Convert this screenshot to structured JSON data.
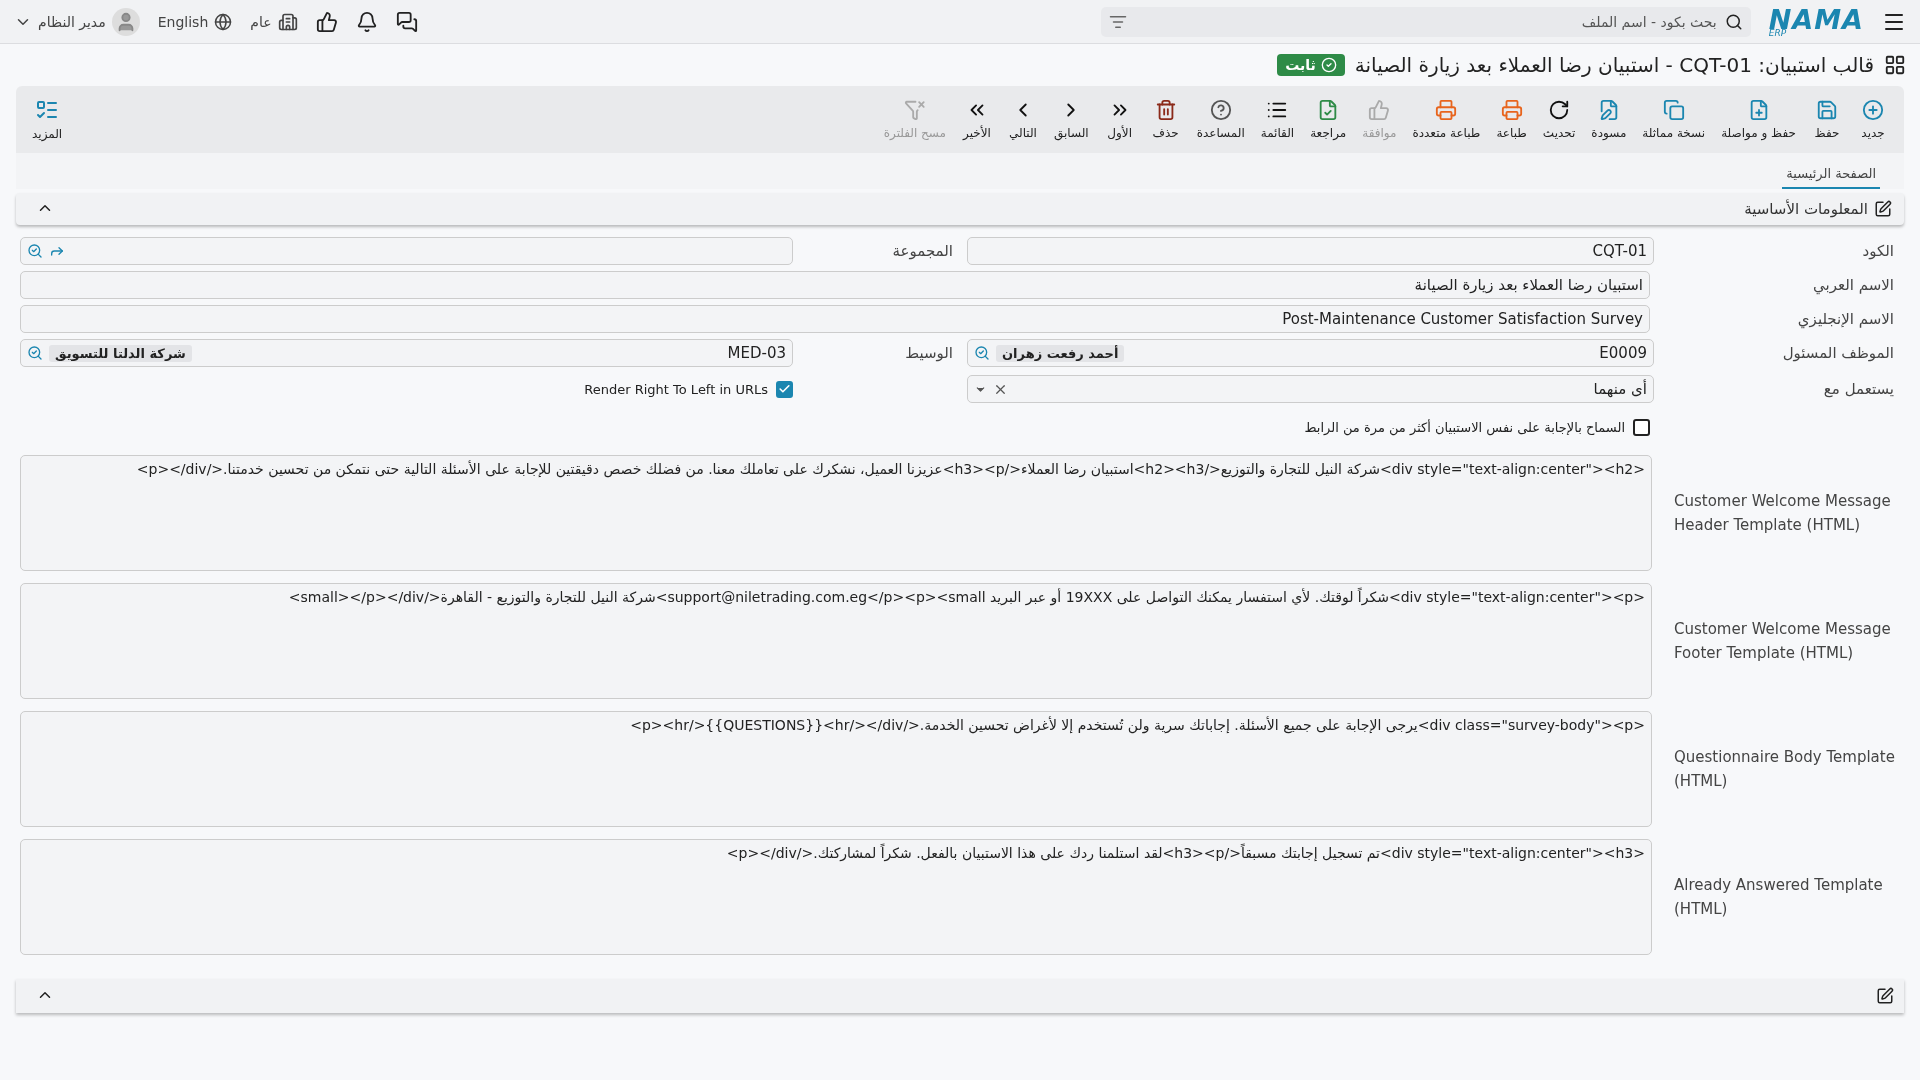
{
  "topbar": {
    "logo": "NAMA",
    "logo_sub": "ERP",
    "search": {
      "placeholder": "بحث بكود - اسم الملف"
    },
    "company": "عام",
    "language": "English",
    "user": "مدير النظام"
  },
  "title": "قالب استبيان: CQT-01 - استبيان رضا العملاء بعد زيارة الصيانة",
  "status_badge": "ثابت",
  "toolbar": [
    {
      "label": "جديد",
      "disabled": false
    },
    {
      "label": "حفظ",
      "disabled": false
    },
    {
      "label": "حفظ و مواصلة",
      "disabled": false
    },
    {
      "label": "نسخة مماثلة",
      "disabled": false
    },
    {
      "label": "مسودة",
      "disabled": false
    },
    {
      "label": "تحديث",
      "disabled": false
    },
    {
      "label": "طباعة",
      "disabled": false
    },
    {
      "label": "طباعة متعددة",
      "disabled": false
    },
    {
      "label": "موافقة",
      "disabled": true
    },
    {
      "label": "مراجعة",
      "disabled": false
    },
    {
      "label": "القائمة",
      "disabled": false
    },
    {
      "label": "المساعدة",
      "disabled": false
    },
    {
      "label": "حذف",
      "disabled": false
    },
    {
      "label": "الأول",
      "disabled": false
    },
    {
      "label": "السابق",
      "disabled": false
    },
    {
      "label": "التالي",
      "disabled": false
    },
    {
      "label": "الأخير",
      "disabled": false
    },
    {
      "label": "مسح الفلترة",
      "disabled": true
    }
  ],
  "more": "المزيد",
  "tabs": [
    {
      "label": "الصفحة الرئيسية",
      "selected": true
    }
  ],
  "section": {
    "title": "المعلومات الأساسية",
    "expanded": true
  },
  "form": {
    "code": {
      "label": "الكود",
      "value": "CQT-01"
    },
    "group": {
      "label": "المجموعة"
    },
    "arabic_name": {
      "label": "الاسم العربي",
      "value": "استبيان رضا العملاء بعد زيارة الصيانة"
    },
    "english_name": {
      "label": "الاسم الإنجليزي",
      "value": "Post-Maintenance Customer Satisfaction Survey"
    },
    "employee": {
      "label": "الموظف المسئول",
      "value": "E0009",
      "chip": "أحمد رفعت زهران"
    },
    "broker": {
      "label": "الوسيط",
      "value": "MED-03",
      "chip": "شركة الدلتا للتسويق"
    },
    "used_with": {
      "label": "يستعمل مع",
      "value": "أى منهما"
    },
    "rtl_urls": {
      "label": "Render Right To Left in URLs",
      "checked": true
    },
    "allow_multiple": {
      "label": "السماح بالإجابة على نفس الاستبيان أكثر من مرة من الرابط",
      "checked": false
    },
    "templates": [
      {
        "label": "Customer Welcome Message Header Template (HTML)",
        "value": "<div style=\"text-align:center\"><h2>شركة النيل للتجارة والتوزيع</h2><h3>استبيان رضا العملاء</h3><p>عزيزنا العميل، نشكرك على تعاملك معنا. من فضلك خصص دقيقتين للإجابة على الأسئلة التالية حتى نتمكن من تحسين خدمتنا.</p></div>"
      },
      {
        "label": "Customer Welcome Message Footer Template (HTML)",
        "value": "<div style=\"text-align:center\"><p>شكراً لوقتك. لأي استفسار يمكنك التواصل على 19XXX أو عبر البريد support@niletrading.com.eg</p><p><small>شركة النيل للتجارة والتوزيع - القاهرة</small></p></div>"
      },
      {
        "label": "Questionnaire Body Template (HTML)",
        "value": "<div class=\"survey-body\"><p>يرجى الإجابة على جميع الأسئلة. إجاباتك سرية ولن تُستخدم إلا لأغراض تحسين الخدمة.</p><hr/>{{QUESTIONS}}<hr/></div>"
      },
      {
        "label": "Already Answered Template (HTML)",
        "value": "<div style=\"text-align:center\"><h3>تم تسجيل إجابتك مسبقاً</h3><p>لقد استلمنا ردك على هذا الاستبيان بالفعل. شكراً لمشاركتك.</p></div>"
      }
    ]
  },
  "bottom_section": {
    "expanded": true
  }
}
